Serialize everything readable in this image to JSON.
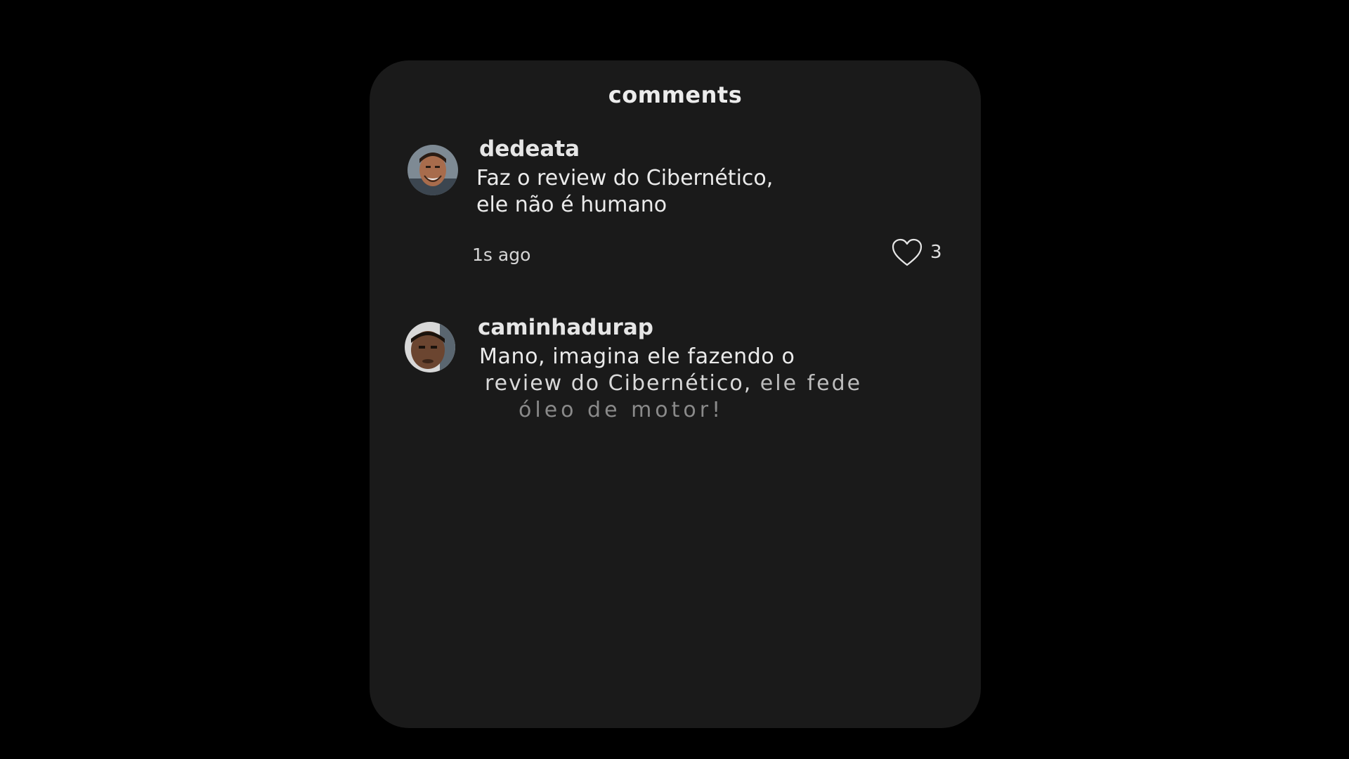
{
  "panel": {
    "title": "comments"
  },
  "comments": [
    {
      "username": "dedeata",
      "lines": [
        "Faz o review do Cibernético,",
        "ele não é humano"
      ],
      "timestamp": "1s ago",
      "likes": "3",
      "like_icon": "heart-outline-icon"
    },
    {
      "username": "caminhadurap",
      "lines": [
        "Mano, imagina ele fazendo o",
        "review do Cibernético,",
        "ele fede",
        "óleo de motor!"
      ]
    }
  ],
  "colors": {
    "background": "#000000",
    "panel": "#1a1a1a",
    "text": "#ebebeb"
  }
}
